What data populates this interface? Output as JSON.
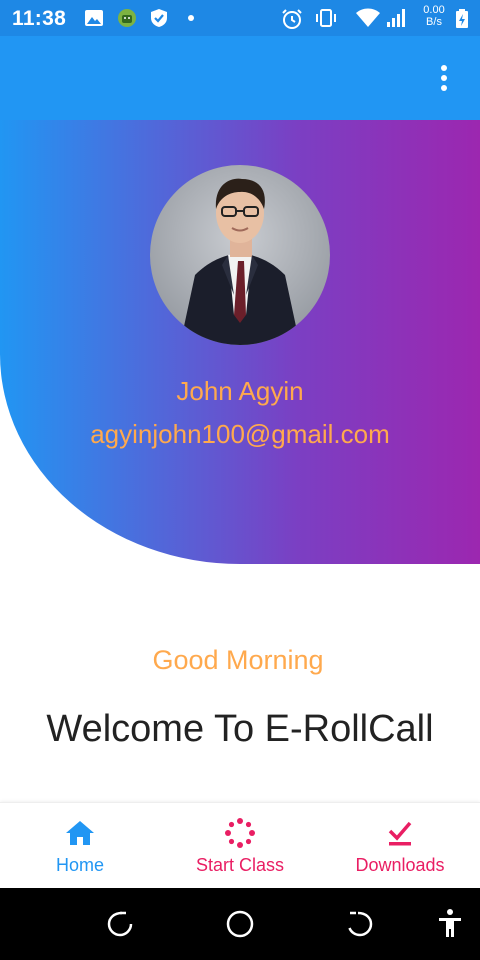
{
  "status_bar": {
    "time": "11:38",
    "net_speed_value": "0.00",
    "net_speed_unit": "B/s",
    "icons": [
      "image-icon",
      "android-icon",
      "shield-check-icon",
      "dot-icon",
      "alarm-icon",
      "vibrate-icon",
      "wifi-icon",
      "signal-icon",
      "battery-icon"
    ]
  },
  "app_bar": {
    "menu_icon": "more-vert-icon"
  },
  "profile": {
    "name": "John Agyin",
    "email": "agyinjohn100@gmail.com"
  },
  "main": {
    "greeting": "Good Morning",
    "welcome": "Welcome To E-RollCall"
  },
  "bottom_nav": {
    "items": [
      {
        "label": "Home",
        "icon": "home-icon",
        "selected": true
      },
      {
        "label": "Start Class",
        "icon": "loading-spinner-icon",
        "selected": false
      },
      {
        "label": "Downloads",
        "icon": "download-done-icon",
        "selected": false
      }
    ]
  },
  "system_nav": {
    "buttons": [
      "back-icon",
      "home-circle-icon",
      "recents-icon",
      "accessibility-icon"
    ]
  },
  "colors": {
    "app_bar": "#2196f3",
    "status_bar": "#1e88e5",
    "gradient_start": "#2196f3",
    "gradient_end": "#9c27b0",
    "accent_orange": "#ffa94d",
    "nav_selected": "#2196f3",
    "nav_unselected": "#e91e63"
  }
}
